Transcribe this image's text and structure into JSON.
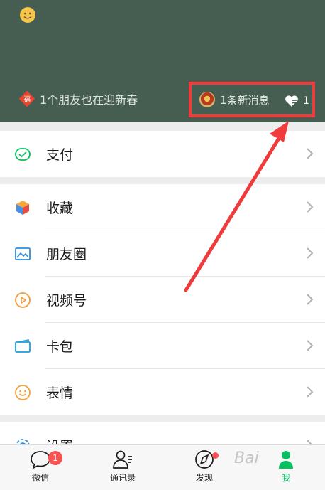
{
  "header": {
    "status_text": "1个朋友也在迎新春",
    "status_badge_char": "福",
    "new_message_text": "1条新消息",
    "like_count": "1",
    "bg_color": "#465e52"
  },
  "menu": {
    "pay": "支付",
    "favorites": "收藏",
    "moments": "朋友圈",
    "channels": "视频号",
    "card_wallet": "卡包",
    "stickers": "表情",
    "settings": "设置"
  },
  "tabbar": {
    "chats": "微信",
    "chats_badge": "1",
    "contacts": "通讯录",
    "discover": "发现",
    "me": "我"
  },
  "watermark": "Bai",
  "colors": {
    "accent_green": "#07c160",
    "badge_red": "#fa5151",
    "highlight_red": "#ef3b3b"
  }
}
